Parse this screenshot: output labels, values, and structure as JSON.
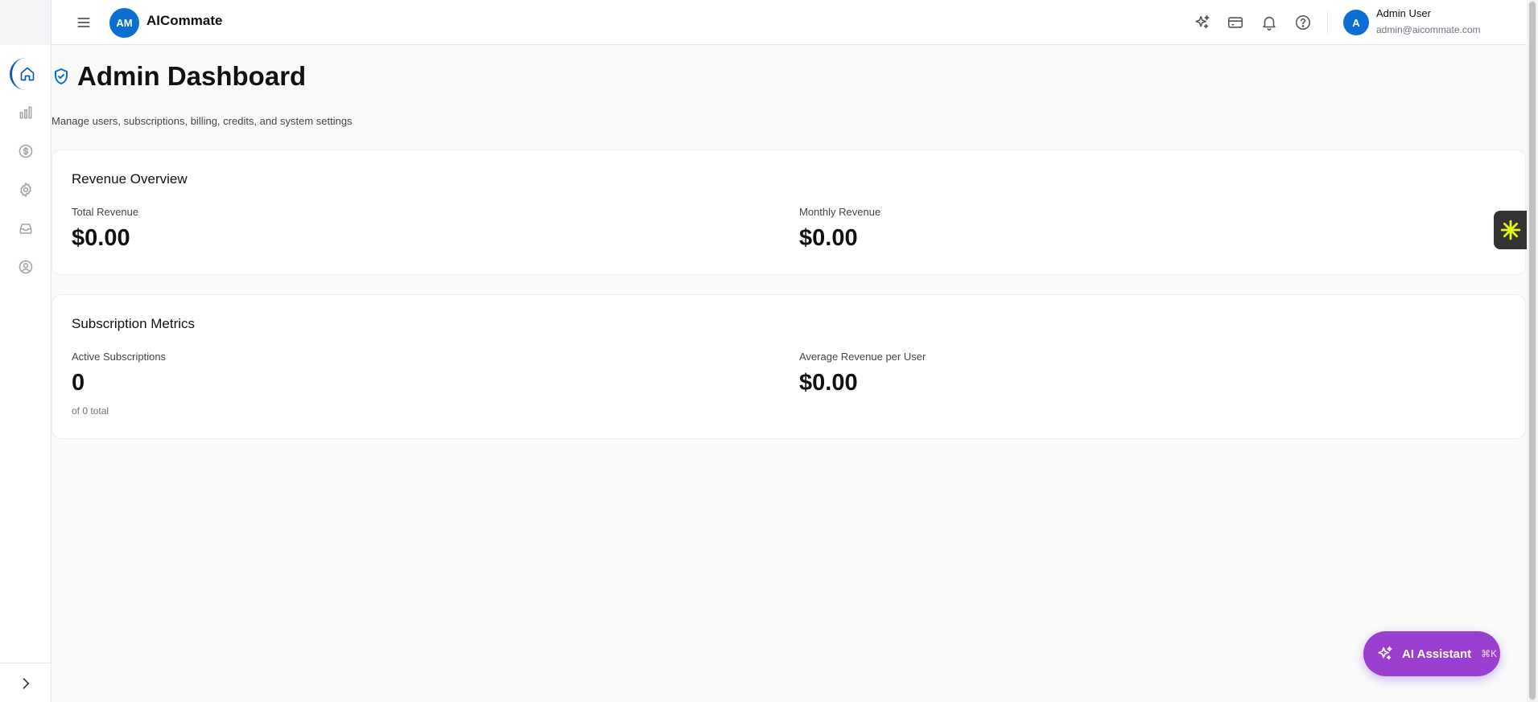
{
  "header": {
    "logo_initials": "AM",
    "app_name": "AICommate",
    "user": {
      "avatar_initial": "A",
      "name": "Admin User",
      "email": "admin@aicommate.com"
    },
    "icons": [
      "sparkles-icon",
      "credit-card-icon",
      "bell-icon",
      "help-icon"
    ]
  },
  "sidebar": {
    "items": [
      {
        "name": "home",
        "icon": "home-icon",
        "active": true
      },
      {
        "name": "analytics",
        "icon": "bar-chart-icon",
        "active": false
      },
      {
        "name": "billing",
        "icon": "dollar-icon",
        "active": false
      },
      {
        "name": "settings",
        "icon": "gear-icon",
        "active": false
      },
      {
        "name": "inbox",
        "icon": "inbox-icon",
        "active": false
      },
      {
        "name": "profile",
        "icon": "user-circle-icon",
        "active": false
      }
    ]
  },
  "page": {
    "title": "Admin Dashboard",
    "subtitle": "Manage users, subscriptions, billing, credits, and system settings"
  },
  "revenue": {
    "title": "Revenue Overview",
    "total_label": "Total Revenue",
    "total_value": "$0.00",
    "monthly_label": "Monthly Revenue",
    "monthly_value": "$0.00"
  },
  "subscriptions": {
    "title": "Subscription Metrics",
    "active_label": "Active Subscriptions",
    "active_value": "0",
    "active_sub": "of 0 total",
    "arpu_label": "Average Revenue per User",
    "arpu_value": "$0.00"
  },
  "ai_assistant": {
    "label": "AI Assistant",
    "shortcut": "⌘K"
  },
  "colors": {
    "brand_blue": "#0b6ed1",
    "ai_purple": "#9b3fd1",
    "widget_yellow": "#e6f51a"
  }
}
